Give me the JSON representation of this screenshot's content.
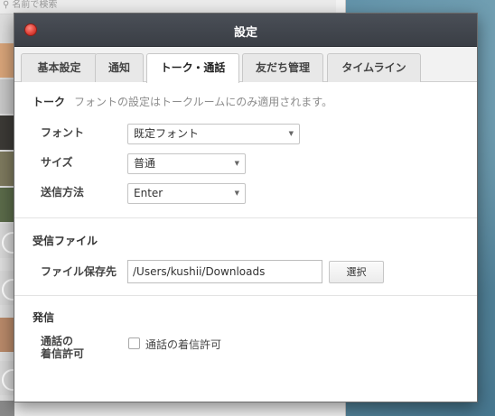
{
  "background": {
    "search_placeholder": "名前で検索"
  },
  "window": {
    "title": "設定",
    "tabs": [
      {
        "label": "基本設定",
        "active": false
      },
      {
        "label": "通知",
        "active": false
      },
      {
        "label": "トーク・通話",
        "active": true
      },
      {
        "label": "友だち管理",
        "active": false
      },
      {
        "label": "タイムライン",
        "active": false
      }
    ]
  },
  "talk": {
    "title": "トーク",
    "note": "フォントの設定はトークルームにのみ適用されます。",
    "font_label": "フォント",
    "font_value": "既定フォント",
    "size_label": "サイズ",
    "size_value": "普通",
    "send_label": "送信方法",
    "send_value": "Enter"
  },
  "received_files": {
    "title": "受信ファイル",
    "save_label": "ファイル保存先",
    "path_value": "/Users/kushii/Downloads",
    "browse_label": "選択"
  },
  "outgoing": {
    "title": "発信",
    "call_label_line1": "通話の",
    "call_label_line2": "着信許可",
    "checkbox_label": "通話の着信許可",
    "checkbox_checked": false
  },
  "colors": {
    "titlebar": "#3f434a",
    "close_button": "#e0443a",
    "accent_text": "#333333"
  }
}
